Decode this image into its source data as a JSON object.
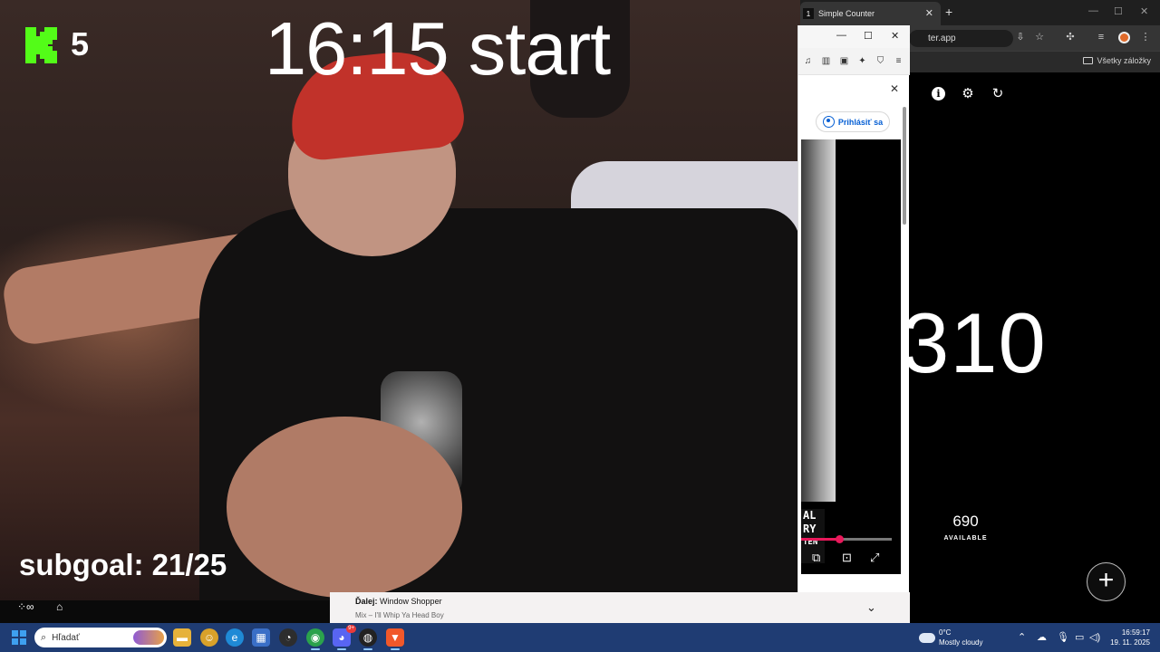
{
  "overlay": {
    "time_text": "16:15 start",
    "kick_count": "5",
    "subgoal_text": "subgoal: 21/25"
  },
  "browser": {
    "tab_number": "1",
    "tab_title": "Simple Counter",
    "url_text": "ter.app",
    "bookmarks_label": "Všetky záložky",
    "icons": {
      "tab_close": "close-icon",
      "new_tab": "plus-icon",
      "install": "install-icon",
      "star": "star-icon",
      "extensions": "puzzle-icon",
      "media": "media-icon",
      "avatar": "profile-avatar",
      "menu": "kebab-menu-icon",
      "bookmarks_folder": "folder-icon"
    }
  },
  "counter": {
    "value": "310",
    "available_number": "690",
    "available_label": "AVAILABLE",
    "icons": [
      "info-icon",
      "gear-icon",
      "refresh-icon",
      "plus-icon"
    ]
  },
  "popup": {
    "signin_label": "Prihlásiť sa",
    "video_logo_text": "AL\nRY\nTEN",
    "progress": 0.42,
    "progress_color": "#e9195b",
    "icons": [
      "music-icon",
      "sidebar-icon",
      "wallet-icon",
      "leo-ai-icon",
      "shield-icon",
      "menu-icon"
    ]
  },
  "next_up": {
    "prefix": "Ďalej:",
    "title": "Window Shopper",
    "subtitle": "Mix – I'll Whip Ya Head Boy"
  },
  "taskbar": {
    "search_placeholder": "Hľadať",
    "weather_temp": "0°C",
    "weather_desc": "Mostly cloudy",
    "time": "16:59:17",
    "date": "19. 11. 2025",
    "notification_badge": "9+",
    "accent_color": "#1f3c73"
  }
}
